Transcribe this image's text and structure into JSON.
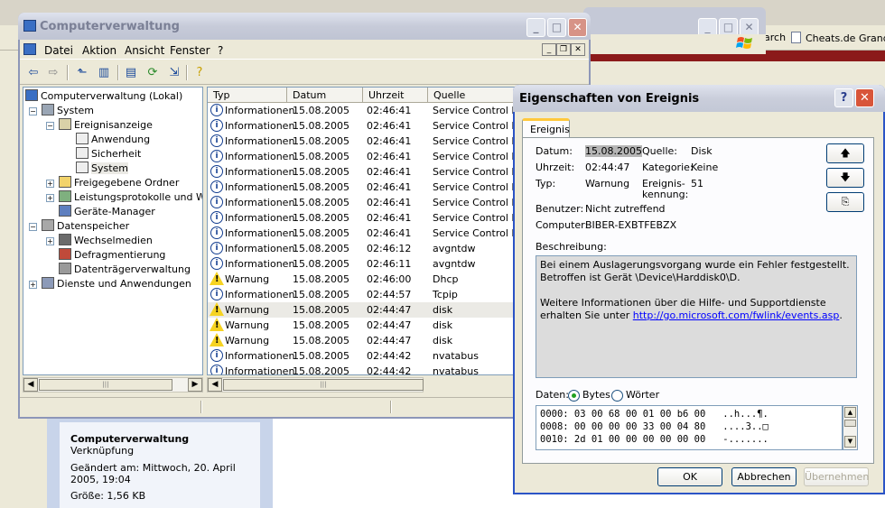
{
  "background": {
    "favorites": [
      {
        "label": "arch"
      },
      {
        "label": "Cheats.de Grand"
      }
    ],
    "info_panel": {
      "title": "Computerverwaltung",
      "type": "Verknüpfung",
      "modified_label": "Geändert am: Mittwoch, 20. April 2005, 19:04",
      "size_label": "Größe: 1,56 KB"
    }
  },
  "main_window": {
    "title": "Computerverwaltung",
    "menu": [
      "Datei",
      "Aktion",
      "Ansicht",
      "Fenster",
      "?"
    ],
    "tree": [
      {
        "label": "Computerverwaltung (Lokal)",
        "icon": "computer-icon"
      },
      {
        "label": "System",
        "icon": "tools-icon"
      },
      {
        "label": "Ereignisanzeige",
        "icon": "event-viewer-icon"
      },
      {
        "label": "Anwendung",
        "icon": "log-icon"
      },
      {
        "label": "Sicherheit",
        "icon": "log-icon"
      },
      {
        "label": "System",
        "icon": "log-icon"
      },
      {
        "label": "Freigegebene Ordner",
        "icon": "folder-icon"
      },
      {
        "label": "Leistungsprotokolle und Warn",
        "icon": "performance-icon"
      },
      {
        "label": "Geräte-Manager",
        "icon": "device-manager-icon"
      },
      {
        "label": "Datenspeicher",
        "icon": "storage-icon"
      },
      {
        "label": "Wechselmedien",
        "icon": "removable-media-icon"
      },
      {
        "label": "Defragmentierung",
        "icon": "defrag-icon"
      },
      {
        "label": "Datenträgerverwaltung",
        "icon": "disk-management-icon"
      },
      {
        "label": "Dienste und Anwendungen",
        "icon": "services-icon"
      }
    ],
    "columns": [
      "Typ",
      "Datum",
      "Uhrzeit",
      "Quelle"
    ],
    "events": [
      {
        "type": "Informationen",
        "date": "15.08.2005",
        "time": "02:46:41",
        "source": "Service Control Ma"
      },
      {
        "type": "Informationen",
        "date": "15.08.2005",
        "time": "02:46:41",
        "source": "Service Control Ma"
      },
      {
        "type": "Informationen",
        "date": "15.08.2005",
        "time": "02:46:41",
        "source": "Service Control Ma"
      },
      {
        "type": "Informationen",
        "date": "15.08.2005",
        "time": "02:46:41",
        "source": "Service Control Ma"
      },
      {
        "type": "Informationen",
        "date": "15.08.2005",
        "time": "02:46:41",
        "source": "Service Control Ma"
      },
      {
        "type": "Informationen",
        "date": "15.08.2005",
        "time": "02:46:41",
        "source": "Service Control Ma"
      },
      {
        "type": "Informationen",
        "date": "15.08.2005",
        "time": "02:46:41",
        "source": "Service Control Ma"
      },
      {
        "type": "Informationen",
        "date": "15.08.2005",
        "time": "02:46:41",
        "source": "Service Control Ma"
      },
      {
        "type": "Informationen",
        "date": "15.08.2005",
        "time": "02:46:41",
        "source": "Service Control Ma"
      },
      {
        "type": "Informationen",
        "date": "15.08.2005",
        "time": "02:46:12",
        "source": "avgntdw"
      },
      {
        "type": "Informationen",
        "date": "15.08.2005",
        "time": "02:46:11",
        "source": "avgntdw"
      },
      {
        "type": "Warnung",
        "date": "15.08.2005",
        "time": "02:46:00",
        "source": "Dhcp"
      },
      {
        "type": "Informationen",
        "date": "15.08.2005",
        "time": "02:44:57",
        "source": "Tcpip"
      },
      {
        "type": "Warnung",
        "date": "15.08.2005",
        "time": "02:44:47",
        "source": "disk",
        "selected": true
      },
      {
        "type": "Warnung",
        "date": "15.08.2005",
        "time": "02:44:47",
        "source": "disk"
      },
      {
        "type": "Warnung",
        "date": "15.08.2005",
        "time": "02:44:47",
        "source": "disk"
      },
      {
        "type": "Informationen",
        "date": "15.08.2005",
        "time": "02:44:42",
        "source": "nvatabus"
      },
      {
        "type": "Informationen",
        "date": "15.08.2005",
        "time": "02:44:42",
        "source": "nvatabus"
      }
    ]
  },
  "dialog": {
    "title": "Eigenschaften von Ereignis",
    "tab": "Ereignis",
    "labels": {
      "date": "Datum:",
      "time": "Uhrzeit:",
      "type": "Typ:",
      "user": "Benutzer:",
      "computer": "Computer:",
      "source": "Quelle:",
      "category": "Kategorie:",
      "event_id_1": "Ereignis-",
      "event_id_2": "kennung:",
      "description": "Beschreibung:",
      "data": "Daten:",
      "bytes": "Bytes",
      "words": "Wörter"
    },
    "values": {
      "date": "15.08.2005",
      "time": "02:44:47",
      "type": "Warnung",
      "user": "Nicht zutreffend",
      "computer": "BIBER-EXBTFEBZX",
      "source": "Disk",
      "category": "Keine",
      "event_id": "51"
    },
    "description": {
      "text1": "Bei einem Auslagerungsvorgang wurde ein Fehler festgestellt. Betroffen ist Gerät \\Device\\Harddisk0\\D.",
      "text2": "Weitere Informationen über die Hilfe- und Supportdienste erhalten Sie unter ",
      "link": "http://go.microsoft.com/fwlink/events.asp",
      "text3": "."
    },
    "data_format_selected": "Bytes",
    "hex_lines": [
      "0000: 03 00 68 00 01 00 b6 00   ..h...¶.",
      "0008: 00 00 00 00 33 00 04 80   ....3..□",
      "0010: 2d 01 00 00 00 00 00 00   -......."
    ],
    "buttons": {
      "ok": "OK",
      "cancel": "Abbrechen",
      "apply": "Übernehmen"
    }
  }
}
